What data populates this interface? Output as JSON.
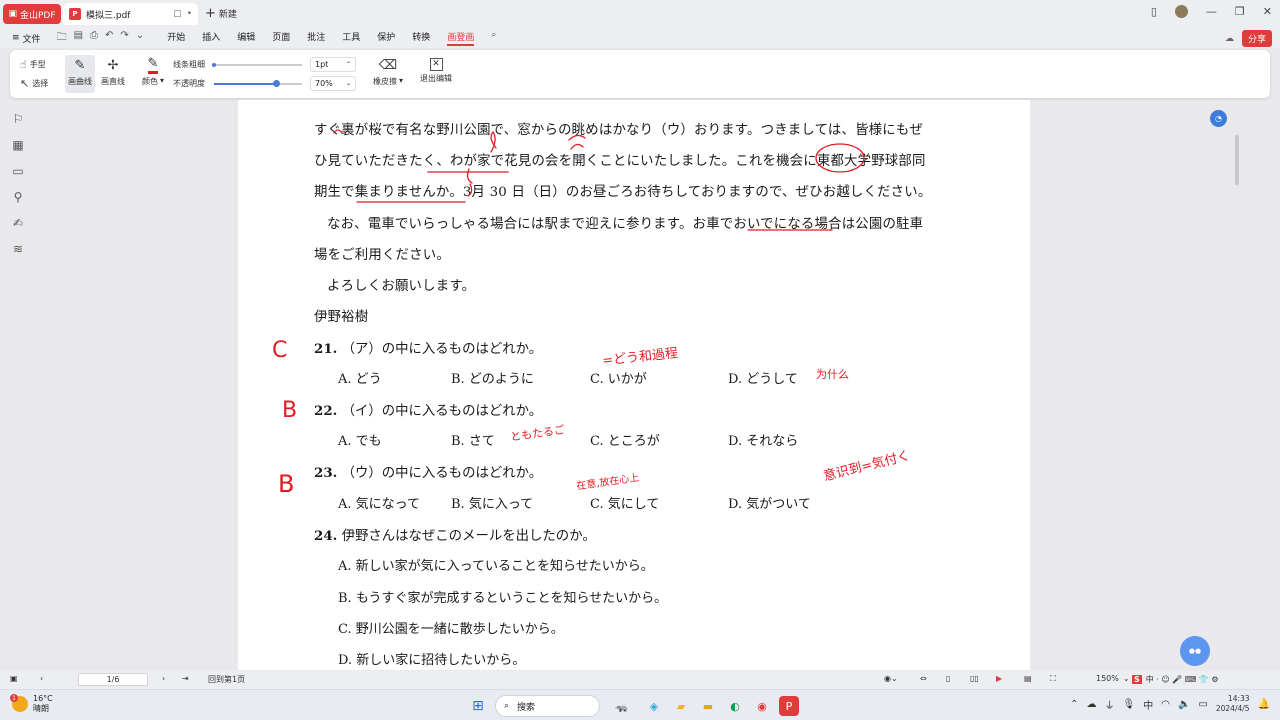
{
  "tabbar": {
    "app_label": "金山PDF",
    "tab_title": "模拟三.pdf",
    "new_tab_label": "新建"
  },
  "menubar": {
    "file_label": "文件",
    "items": [
      "开始",
      "插入",
      "编辑",
      "页面",
      "批注",
      "工具",
      "保护",
      "转换",
      "画登画"
    ],
    "share_label": "分享"
  },
  "ribbon": {
    "hand_label": "手型",
    "select_label": "选择",
    "pen_label": "画曲线",
    "line_label": "画直线",
    "color_label": "颜色",
    "thickness_label": "线条粗细",
    "opacity_label": "不透明度",
    "thickness_value": "1pt",
    "opacity_value": "70%",
    "eraser_label": "橡皮擦",
    "exit_label": "退出编辑",
    "pen_color": "#e21b23",
    "opacity_level": 0.7
  },
  "document": {
    "partial_top": "すぐ裏が桜で有名な野川公園で、窓からの眺めはかなり（ウ）おります。つきましては、皆様にもぜ",
    "para_line2": "ひ見ていただきたく、わが家で花見の会を開くことにいたしました。これを機会に東都大学野球部同",
    "para_line3": "期生で集まりませんか。3月 30 日（日）のお昼ごろお待ちしておりますので、ぜひお越しください。",
    "para_line4": "なお、電車でいらっしゃる場合には駅まで迎えに参ります。お車でおいでになる場合は公園の駐車",
    "para_line5": "場をご利用ください。",
    "para_line6": "よろしくお願いします。",
    "signature": "伊野裕樹",
    "questions": [
      {
        "number": "21.",
        "text": "（ア）の中に入るものはどれか。",
        "options": [
          {
            "letter": "A.",
            "text": "どう"
          },
          {
            "letter": "B.",
            "text": "どのように"
          },
          {
            "letter": "C.",
            "text": "いかが"
          },
          {
            "letter": "D.",
            "text": "どうして"
          }
        ]
      },
      {
        "number": "22.",
        "text": "（イ）の中に入るものはどれか。",
        "options": [
          {
            "letter": "A.",
            "text": "でも"
          },
          {
            "letter": "B.",
            "text": "さて"
          },
          {
            "letter": "C.",
            "text": "ところが"
          },
          {
            "letter": "D.",
            "text": "それなら"
          }
        ]
      },
      {
        "number": "23.",
        "text": "（ウ）の中に入るものはどれか。",
        "options": [
          {
            "letter": "A.",
            "text": "気になって"
          },
          {
            "letter": "B.",
            "text": "気に入って"
          },
          {
            "letter": "C.",
            "text": "気にして"
          },
          {
            "letter": "D.",
            "text": "気がついて"
          }
        ]
      },
      {
        "number": "24.",
        "text": "伊野さんはなぜこのメールを出したのか。",
        "options": [
          {
            "letter": "A.",
            "text": "新しい家が気に入っていることを知らせたいから。"
          },
          {
            "letter": "B.",
            "text": "もうすぐ家が完成するということを知らせたいから。"
          },
          {
            "letter": "C.",
            "text": "野川公園を一緒に散歩したいから。"
          },
          {
            "letter": "D.",
            "text": "新しい家に招待したいから。"
          }
        ]
      }
    ]
  },
  "handwriting": {
    "ans21": "C",
    "ans22": "B",
    "ans23": "B",
    "note_q21": "=どう和過程",
    "note_q21_d": "为什么",
    "note_q22": "ともたるご",
    "note_q23_right": "意识到=気付く",
    "note_q23_c": "在意,放在心上"
  },
  "statusbar": {
    "page_indicator": "1/6",
    "back_label": "回到第1页",
    "zoom": "150%"
  },
  "taskbar": {
    "temperature": "16°C",
    "weather": "晴朗",
    "weather_badge": "1",
    "search_placeholder": "搜索",
    "time": "14:33",
    "date": "2024/4/5"
  }
}
